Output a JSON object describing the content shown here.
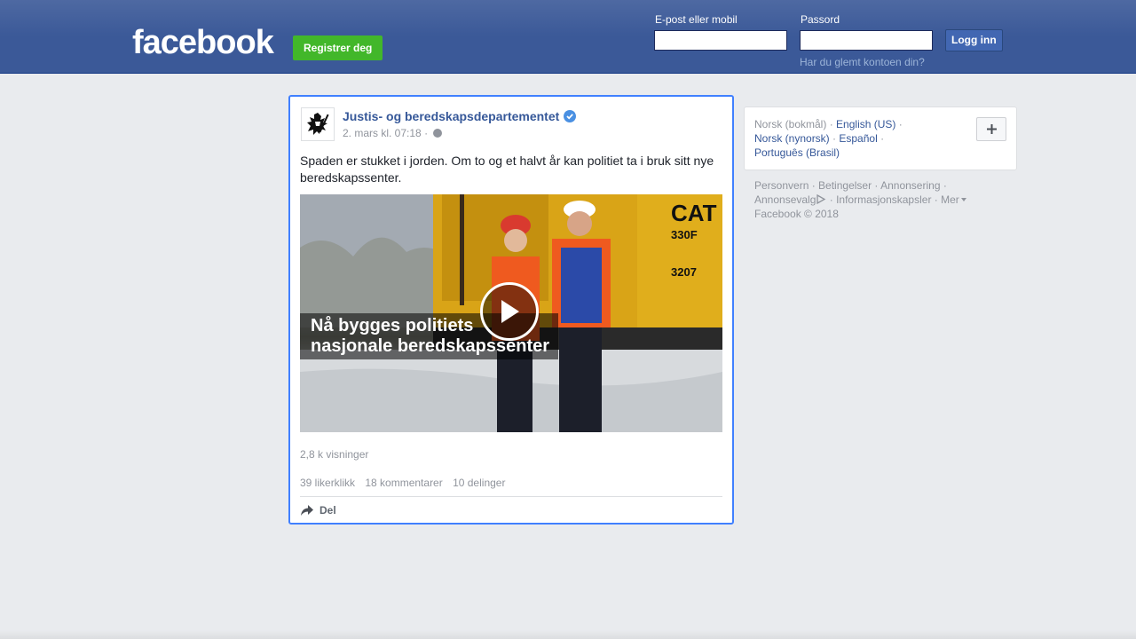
{
  "header": {
    "logo": "facebook",
    "register_label": "Registrer deg",
    "email_label": "E-post eller mobil",
    "password_label": "Passord",
    "login_label": "Logg inn",
    "forgot_label": "Har du glemt kontoen din?",
    "email_value": "",
    "password_value": ""
  },
  "post": {
    "page_name": "Justis- og beredskapsdepartementet",
    "timestamp": "2. mars kl. 07:18",
    "meta_separator": "·",
    "text": "Spaden er stukket i jorden. Om to og et halvt år kan politiet ta i bruk sitt nye beredskapssenter.",
    "video_caption_line1": "Nå bygges politiets",
    "video_caption_line2": "nasjonale beredskapssenter",
    "video_overlay_text": "CAT 330F 3207",
    "views": "2,8 k visninger",
    "likes": "39 likerklikk",
    "comments": "18 kommentarer",
    "shares": "10 delinger",
    "share_action": "Del"
  },
  "languages": {
    "current": "Norsk (bokmål)",
    "items": [
      "English (US)",
      "Norsk (nynorsk)",
      "Español",
      "Português (Brasil)"
    ],
    "separator": "·"
  },
  "footer": {
    "links": [
      "Personvern",
      "Betingelser",
      "Annonsering",
      "Annonsevalg",
      "Informasjonskapsler",
      "Mer"
    ],
    "copyright": "Facebook © 2018"
  },
  "colors": {
    "brand_blue": "#3b5998",
    "link_blue": "#365899",
    "register_green": "#42b72a",
    "focus_border": "#4080ff"
  }
}
